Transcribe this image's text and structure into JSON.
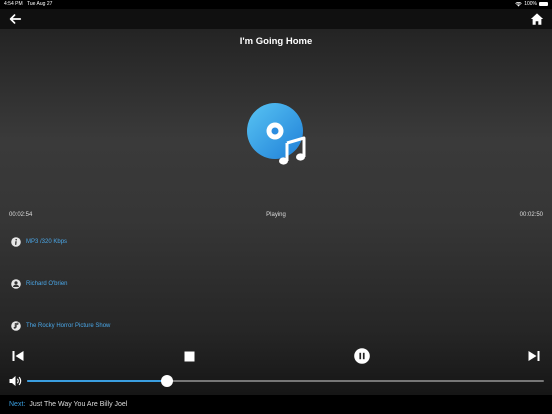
{
  "status_bar": {
    "time": "4:54 PM",
    "date": "Tue Aug 27",
    "battery": "100%"
  },
  "header": {
    "back_icon": "arrow-left-icon",
    "home_icon": "home-icon"
  },
  "song": {
    "title": "I'm Going Home"
  },
  "playback": {
    "elapsed": "00:02:54",
    "state": "Playing",
    "duration": "00:02:50"
  },
  "details": [
    {
      "icon": "info-icon",
      "text": "MP3 /320 Kbps"
    },
    {
      "icon": "person-icon",
      "text": "Richard O'brien"
    },
    {
      "icon": "music-note-icon",
      "text": "The Rocky Horror Picture Show"
    }
  ],
  "controls": [
    "skip-previous-icon",
    "stop-icon",
    "pause-icon",
    "skip-next-icon"
  ],
  "volume": {
    "level": 0.27,
    "icon": "volume-icon"
  },
  "next": {
    "label": "Next",
    "separator": ":",
    "track": "Just The Way You Are Billy Joel"
  },
  "colors": {
    "accent": "#3a9ee0",
    "link": "#4aa7e8"
  }
}
